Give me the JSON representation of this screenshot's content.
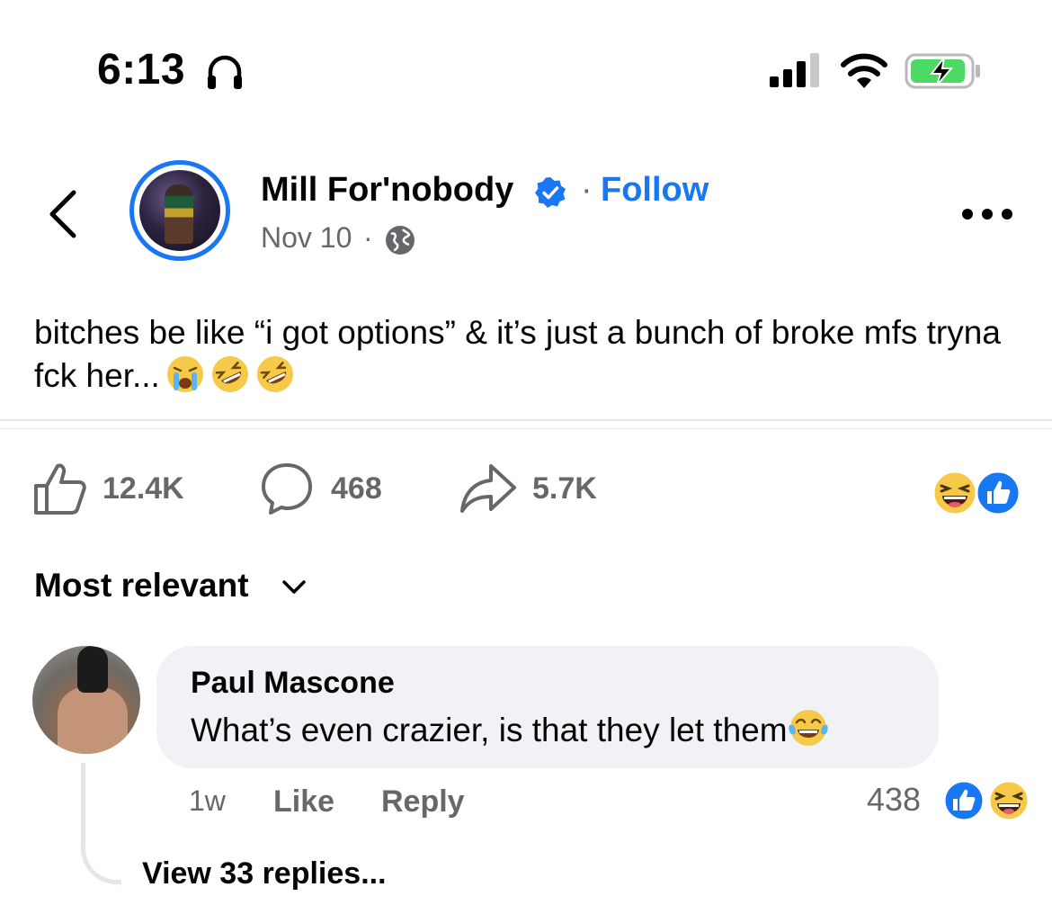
{
  "status_bar": {
    "time": "6:13",
    "icons": [
      "headphones-icon",
      "cellular-signal-icon",
      "wifi-icon",
      "battery-charging-icon"
    ]
  },
  "post": {
    "author": "Mill For'nobody",
    "verified": true,
    "follow_label": "Follow",
    "date": "Nov 10",
    "audience_icon": "globe-icon",
    "text": "bitches be like “i got options” & it’s just a bunch of broke mfs tryna fck her...",
    "text_emojis": [
      "loudly-crying-face",
      "rolling-on-floor-laughing",
      "rolling-on-floor-laughing"
    ],
    "stats": {
      "likes": "12.4K",
      "comments": "468",
      "shares": "5.7K"
    },
    "reactions": [
      "haha",
      "like"
    ]
  },
  "comments_section": {
    "sort_label": "Most relevant",
    "comments": [
      {
        "author": "Paul Mascone",
        "text": "What’s even crazier, is that they let them",
        "emoji": "face-with-tears-of-joy",
        "time": "1w",
        "like_label": "Like",
        "reply_label": "Reply",
        "reaction_count": "438",
        "reactions": [
          "like",
          "haha"
        ],
        "view_replies_label": "View 33 replies..."
      }
    ]
  },
  "colors": {
    "accent_blue": "#1877f2",
    "secondary_text": "#65676b",
    "bubble_bg": "#f0f2f5",
    "divider": "#e4e6eb"
  }
}
